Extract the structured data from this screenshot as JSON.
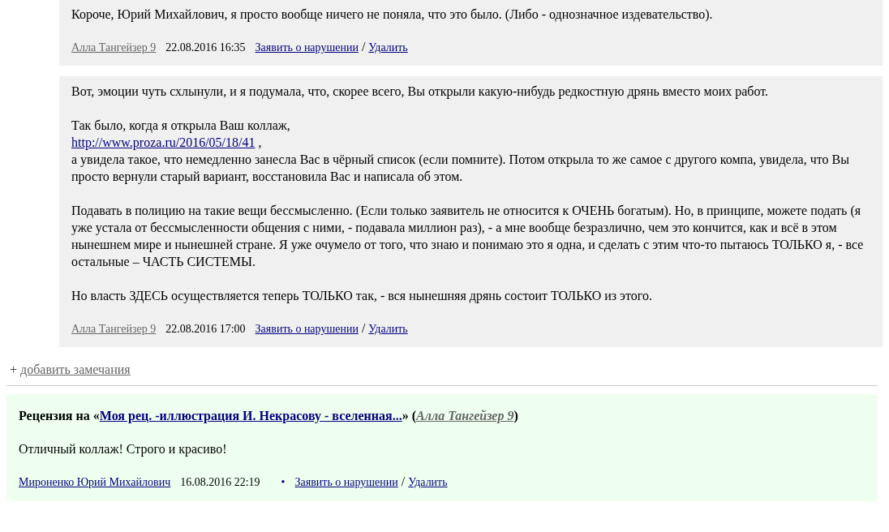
{
  "comments": [
    {
      "paragraphs": [
        [
          {
            "kind": "text",
            "text": "Короче, Юрий Михайлович, я просто вообще ничего не поняла, что это было. (Либо - однозначное издевательство)."
          }
        ]
      ],
      "footer": {
        "author": "Алла Тангейзер 9",
        "date": "22.08.2016 16:35",
        "report": "Заявить о нарушении",
        "separator": "/",
        "delete": "Удалить"
      }
    },
    {
      "paragraphs": [
        [
          {
            "kind": "text",
            "text": "Вот, эмоции чуть схлынули, и я подумала, что, скорее всего, Вы открыли какую-нибудь редкостную дрянь вместо моих работ."
          }
        ],
        [
          {
            "kind": "text",
            "text": "Так было, когда я открыла Ваш коллаж,"
          },
          {
            "kind": "break"
          },
          {
            "kind": "link",
            "text": "http://www.proza.ru/2016/05/18/41"
          },
          {
            "kind": "text",
            "text": " ,"
          },
          {
            "kind": "break"
          },
          {
            "kind": "text",
            "text": "а увидела такое, что немедленно занесла Вас в чёрный список (если помните). Потом открыла то же самое с другого компа, увидела, что Вы просто вернули старый вариант, восстановила Вас и написала об этом."
          }
        ],
        [
          {
            "kind": "text",
            "text": "Подавать в полицию на такие вещи бессмысленно. (Если только заявитель не относится к ОЧЕНЬ богатым). Но, в принципе, можете подать (я уже устала от бессмысленности общения с ними, - подавала миллион раз), - а мне вообще безразлично, чем это кончится, как и всё в этом нынешнем мире и нынешней стране. Я уже очумело от того, что знаю и понимаю это я одна, и сделать с этим что-то пытаюсь ТОЛЬКО я, - все остальные – ЧАСТЬ СИСТЕМЫ."
          }
        ],
        [
          {
            "kind": "text",
            "text": "Но власть ЗДЕСЬ осуществляется теперь ТОЛЬКО так, - вся нынешняя дрянь состоит ТОЛЬКО из этого."
          }
        ]
      ],
      "footer": {
        "author": "Алла Тангейзер 9",
        "date": "22.08.2016 17:00",
        "report": "Заявить о нарушении",
        "separator": "/",
        "delete": "Удалить"
      }
    }
  ],
  "add_remarks": {
    "prefix": "+",
    "link": "добавить замечания"
  },
  "review": {
    "title": [
      {
        "kind": "text",
        "text": "Рецензия на «"
      },
      {
        "kind": "link",
        "text": "Моя рец. -иллюстрация И. Некрасову - вселенная..."
      },
      {
        "kind": "text",
        "text": "» ("
      },
      {
        "kind": "author",
        "text": "Алла Тангейзер 9"
      },
      {
        "kind": "text",
        "text": ")"
      }
    ],
    "body": "Отличный коллаж! Строго и красиво!",
    "footer": {
      "author": "Мироненко Юрий Михайлович",
      "date": "16.08.2016 22:19",
      "bullet": "•",
      "report": "Заявить о нарушении",
      "separator": "/",
      "delete": "Удалить"
    }
  }
}
